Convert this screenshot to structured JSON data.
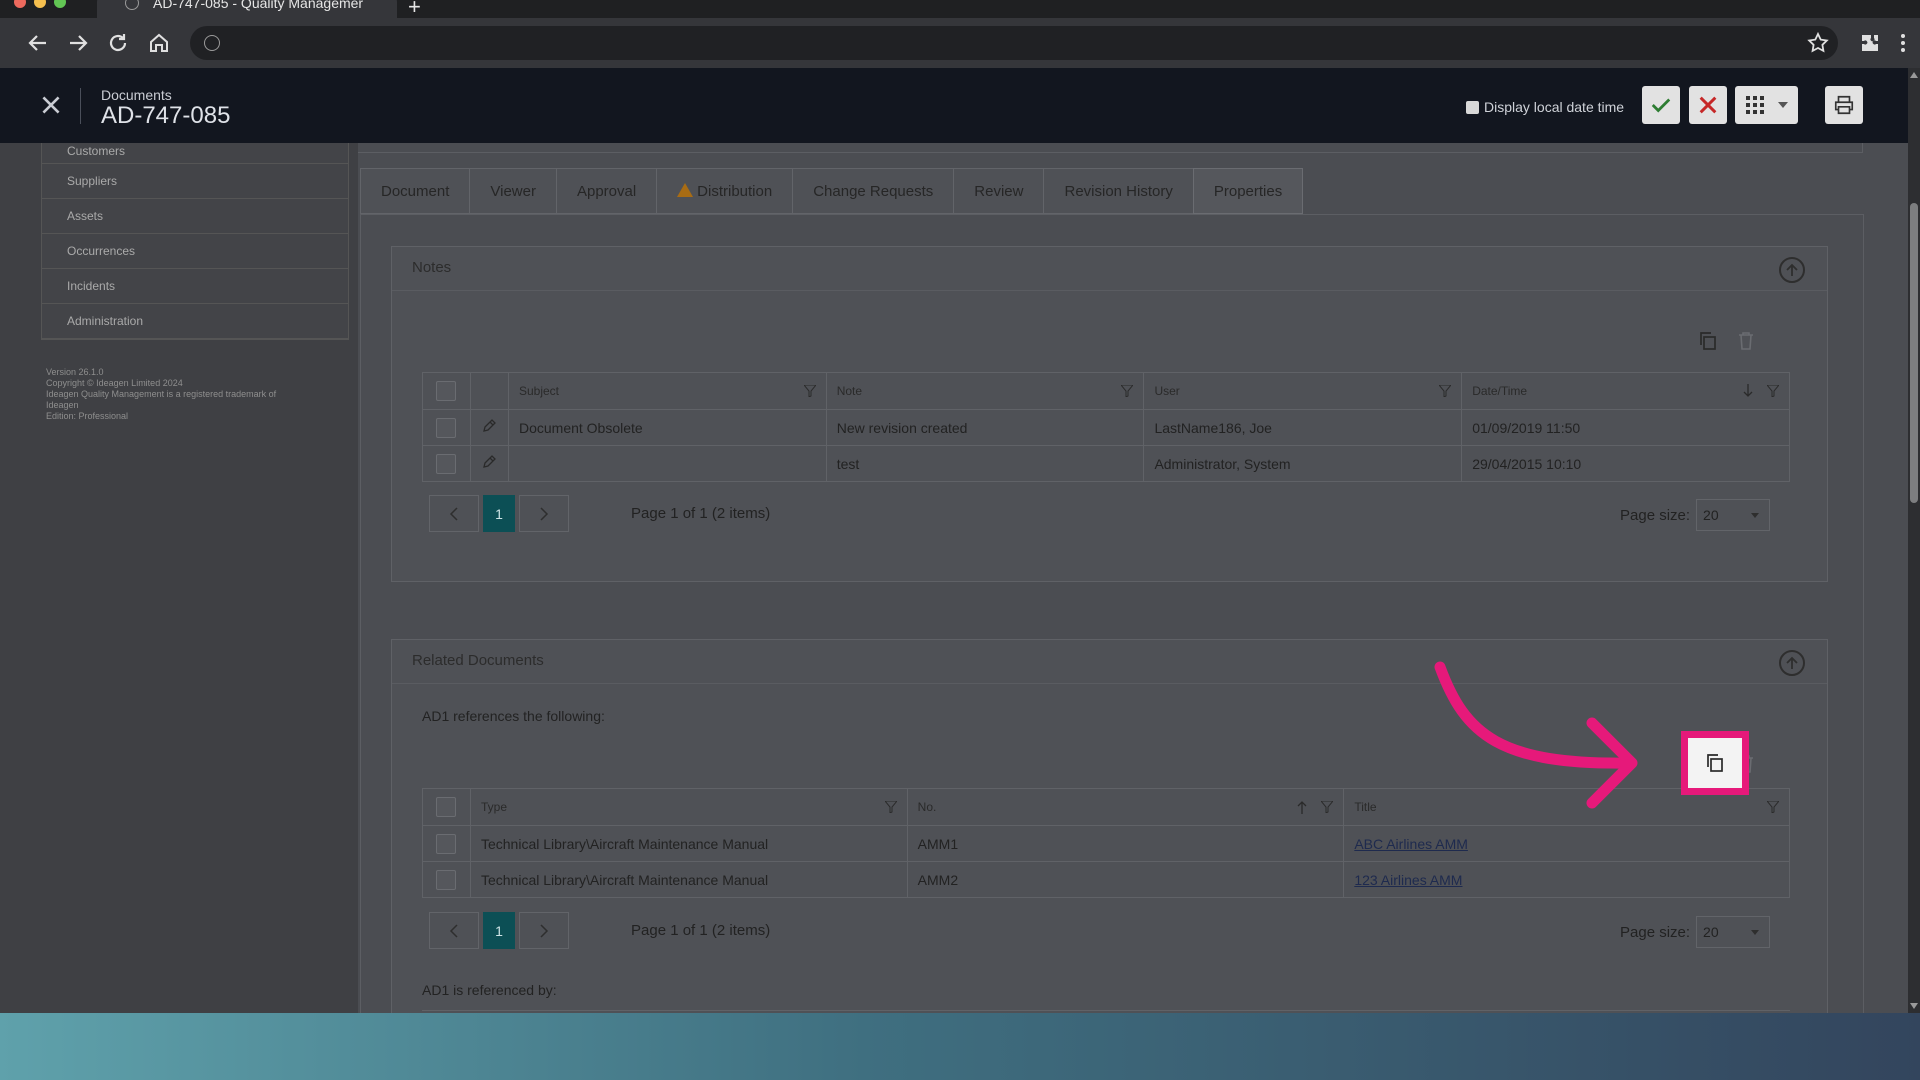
{
  "browser": {
    "tab_title": "AD-747-085 - Quality Managemer",
    "new_tab_label": "+"
  },
  "header": {
    "category": "Documents",
    "title": "AD-747-085",
    "display_local_date_time": "Display local date time"
  },
  "sidebar": {
    "items": [
      {
        "label": "Customers"
      },
      {
        "label": "Suppliers"
      },
      {
        "label": "Assets"
      },
      {
        "label": "Occurrences"
      },
      {
        "label": "Incidents"
      },
      {
        "label": "Administration"
      }
    ],
    "version_lines": [
      "Version 26.1.0",
      "Copyright © Ideagen Limited 2024",
      "Ideagen Quality Management is a registered trademark of",
      "Ideagen",
      "Edition: Professional"
    ]
  },
  "tabs": [
    {
      "label": "Document"
    },
    {
      "label": "Viewer"
    },
    {
      "label": "Approval"
    },
    {
      "label": "Distribution"
    },
    {
      "label": "Change Requests"
    },
    {
      "label": "Review"
    },
    {
      "label": "Revision History"
    },
    {
      "label": "Properties"
    }
  ],
  "notes": {
    "title": "Notes",
    "columns": [
      "Subject",
      "Note",
      "User",
      "Date/Time"
    ],
    "rows": [
      {
        "subject": "Document Obsolete",
        "note": "New revision created",
        "user": "LastName186, Joe",
        "datetime": "01/09/2019 11:50"
      },
      {
        "subject": "",
        "note": "test",
        "user": "Administrator, System",
        "datetime": "29/04/2015 10:10"
      }
    ],
    "pager": {
      "current_page": "1",
      "info": "Page 1 of 1 (2 items)",
      "page_size_label": "Page size:",
      "page_size": "20"
    }
  },
  "related": {
    "title": "Related Documents",
    "references_caption": "AD1 references the following:",
    "columns": [
      "Type",
      "No.",
      "Title"
    ],
    "rows": [
      {
        "type": "Technical Library\\Aircraft Maintenance Manual",
        "no": "AMM1",
        "title": "ABC Airlines AMM"
      },
      {
        "type": "Technical Library\\Aircraft Maintenance Manual",
        "no": "AMM2",
        "title": "123 Airlines AMM"
      }
    ],
    "pager": {
      "current_page": "1",
      "info": "Page 1 of 1 (2 items)",
      "page_size_label": "Page size:",
      "page_size": "20"
    },
    "referenced_by_caption": "AD1 is referenced by:"
  },
  "colors": {
    "highlight": "#e6197a",
    "pager_active": "#0c4f55",
    "confirm": "#2e7d32",
    "cancel": "#c62828"
  }
}
